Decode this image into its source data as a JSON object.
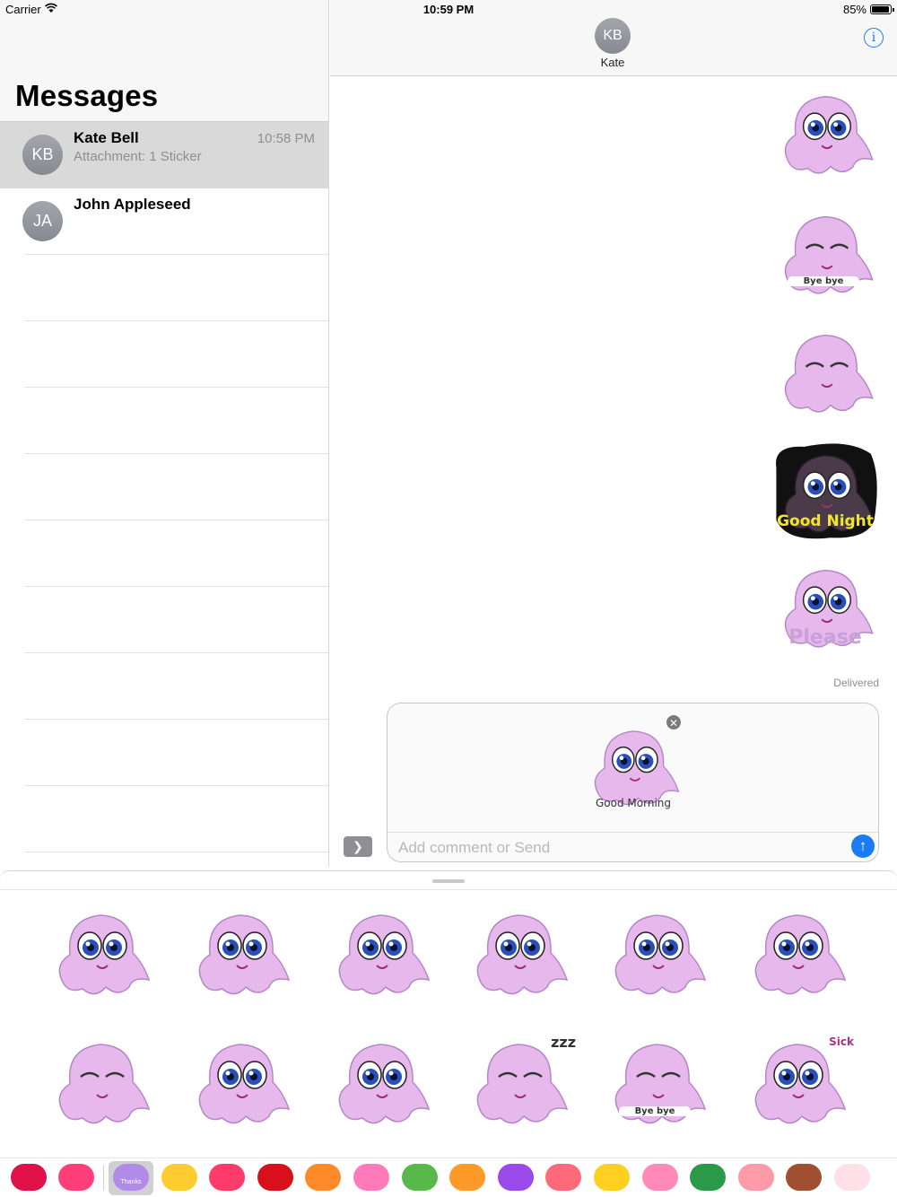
{
  "status_bar": {
    "carrier": "Carrier",
    "time": "10:59 PM",
    "battery": "85%",
    "battery_level": 0.85
  },
  "sidebar": {
    "title": "Messages",
    "conversations": [
      {
        "initials": "KB",
        "name": "Kate Bell",
        "preview": "Attachment: 1 Sticker",
        "time": "10:58 PM",
        "selected": true
      },
      {
        "initials": "JA",
        "name": "John Appleseed",
        "preview": "",
        "time": "",
        "selected": false
      }
    ]
  },
  "conversation": {
    "contact_initials": "KB",
    "contact_name": "Kate",
    "info_icon": "info-icon",
    "messages": [
      {
        "type": "sticker",
        "sticker": "angry-octopus",
        "caption": ""
      },
      {
        "type": "sticker",
        "sticker": "bye-bye-octopus",
        "caption": "Bye bye"
      },
      {
        "type": "sticker",
        "sticker": "happy-waving-octopus",
        "caption": ""
      },
      {
        "type": "sticker",
        "sticker": "good-night-octopus",
        "caption": "Good Night"
      },
      {
        "type": "sticker",
        "sticker": "please-octopus",
        "caption": "Please"
      }
    ],
    "delivered": "Delivered"
  },
  "compose": {
    "pending_sticker": "good-morning-octopus",
    "pending_caption": "Good Morning",
    "placeholder": "Add comment or Send"
  },
  "sticker_drawer": {
    "stickers": [
      {
        "name": "angry",
        "caption": ""
      },
      {
        "name": "tongue-out",
        "caption": ""
      },
      {
        "name": "shy",
        "caption": ""
      },
      {
        "name": "peeking-curtain",
        "caption": ""
      },
      {
        "name": "surprised",
        "caption": ""
      },
      {
        "name": "frustrated",
        "caption": ""
      },
      {
        "name": "waving",
        "caption": ""
      },
      {
        "name": "cheerful",
        "caption": ""
      },
      {
        "name": "worried",
        "caption": ""
      },
      {
        "name": "sleeping",
        "caption": "zzz"
      },
      {
        "name": "bye-bye",
        "caption": "Bye bye"
      },
      {
        "name": "sick",
        "caption": "Sick"
      }
    ]
  },
  "app_tray": {
    "selected_label": "Thanks",
    "colors": [
      "#e01048",
      "#ff3e7a",
      "#b08be8",
      "#ffcc2f",
      "#ff3b6b",
      "#d8101c",
      "#ff8a2a",
      "#ff7ab8",
      "#58b84a",
      "#ff9a28",
      "#9a4ae8",
      "#ff6a7a",
      "#ffd020",
      "#ff8ab8",
      "#2a9a48",
      "#ff9aa8",
      "#a05030",
      "#ffe0e8"
    ]
  },
  "colors": {
    "accent": "#1a7cf5",
    "sticker_pink": "#e6b8ec",
    "eye_blue": "#2b4fb8"
  }
}
